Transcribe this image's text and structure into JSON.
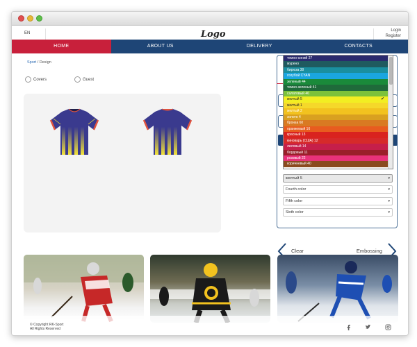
{
  "header": {
    "lang": "EN",
    "logo": "Logo",
    "login": "Login",
    "register": "Register"
  },
  "nav": {
    "items": [
      {
        "label": "HOME",
        "active": true
      },
      {
        "label": "ABOUT US",
        "active": false
      },
      {
        "label": "DELIVERY",
        "active": false
      },
      {
        "label": "CONTACTS",
        "active": false
      }
    ]
  },
  "breadcrumb": {
    "sport": "Sport",
    "separator": "/",
    "design": "Design"
  },
  "options": {
    "covers": "Covers",
    "guest": "Guest"
  },
  "jersey": {
    "body_color": "#3a3a8e",
    "stripe_gradient_top": "#3a3a8e",
    "stripe_gradient_bottom": "#f2e23a",
    "trim_color": "#e0533f",
    "accent_color": "#1f1f4a"
  },
  "color_dropdown": {
    "items": [
      {
        "label": "темно-синий 27",
        "color": "#2a2a6e"
      },
      {
        "label": "мурено",
        "color": "#1f5a5f"
      },
      {
        "label": "бирюза 38",
        "color": "#1a8fa0"
      },
      {
        "label": "голубой CYAN",
        "color": "#1aa6e0"
      },
      {
        "label": "зеленый 44",
        "color": "#1a8a3a"
      },
      {
        "label": "темно-зеленый 41",
        "color": "#1f6a3a"
      },
      {
        "label": "салатовый 46",
        "color": "#7cc23a"
      },
      {
        "label": "желтый 5",
        "color": "#f2ee22",
        "light": true,
        "selected": true
      },
      {
        "label": "желтый 1",
        "color": "#f5d82a",
        "light": true
      },
      {
        "label": "желтый 2",
        "color": "#f2c21f"
      },
      {
        "label": "золото 4",
        "color": "#d9a020"
      },
      {
        "label": "бронза 60",
        "color": "#d97a22"
      },
      {
        "label": "оранжевый 16",
        "color": "#e85c1f"
      },
      {
        "label": "красный 13",
        "color": "#d9231f"
      },
      {
        "label": "киноварь (США) 12",
        "color": "#d62a2a"
      },
      {
        "label": "лиловый 14",
        "color": "#c61f4a"
      },
      {
        "label": "бордовый 11",
        "color": "#9a1f2a"
      },
      {
        "label": "розовый 22",
        "color": "#e8327a"
      },
      {
        "label": "коричневый 40",
        "color": "#8a4a1f"
      }
    ]
  },
  "color_selects": {
    "current": "желтый 5",
    "fourth": "Fourth color",
    "fifth": "Fifth color",
    "sixth": "Sixth color"
  },
  "actions": {
    "clear": "Clear",
    "embossing": "Embossing"
  },
  "footer": {
    "copyright_line1": "© Copyright RK-Sport",
    "copyright_line2": "All Rights Reserved"
  },
  "colors": {
    "nav_bg": "#1e4576",
    "nav_active": "#c8203b",
    "panel_border": "#4b6f96",
    "link": "#2b6ab3"
  },
  "icons": [
    "chevron-left-icon",
    "chevron-right-icon",
    "facebook-icon",
    "twitter-icon",
    "instagram-icon",
    "checkmark-icon"
  ]
}
